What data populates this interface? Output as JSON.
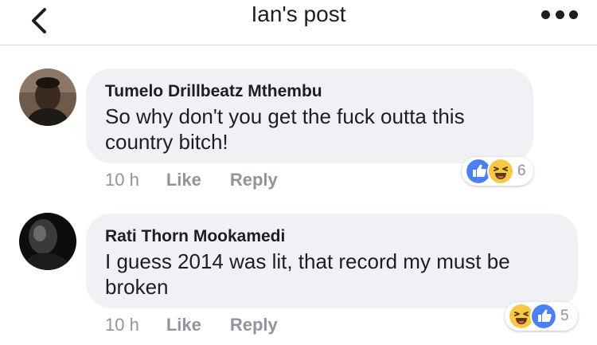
{
  "header": {
    "title": "Ian's post"
  },
  "comments": [
    {
      "author": "Tumelo Drillbeatz Mthembu",
      "text_line1": "So why don't you get the fuck outta this",
      "text_line2": "country bitch!",
      "time": "10 h",
      "like_label": "Like",
      "reply_label": "Reply",
      "reaction_count": "6",
      "reaction_icons": [
        "like-icon",
        "haha-icon"
      ]
    },
    {
      "author": "Rati Thorn Mookamedi",
      "text_line1": "I guess 2014 was lit, that record my must be",
      "text_line2": "broken",
      "time": "10 h",
      "like_label": "Like",
      "reply_label": "Reply",
      "reaction_count": "5",
      "reaction_icons": [
        "haha-icon",
        "like-icon"
      ]
    }
  ],
  "colors": {
    "like_blue": "#4a80f0",
    "haha_yellow": "#f7c843",
    "bubble_bg": "#f0f1f5",
    "meta_gray": "#90949c"
  }
}
